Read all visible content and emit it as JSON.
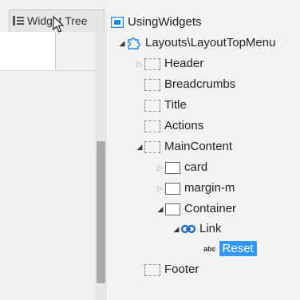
{
  "panel": {
    "tab_label": "Widget Tree"
  },
  "tree": [
    {
      "label": "UsingWidgets",
      "icon": "screen-icon",
      "caret": "none"
    },
    {
      "label": "Layouts\\LayoutTopMenu",
      "icon": "puzzle-icon",
      "caret": "open"
    },
    {
      "label": "Header",
      "icon": "placeholder-icon",
      "caret": "closed"
    },
    {
      "label": "Breadcrumbs",
      "icon": "placeholder-icon",
      "caret": "none"
    },
    {
      "label": "Title",
      "icon": "placeholder-icon",
      "caret": "none"
    },
    {
      "label": "Actions",
      "icon": "placeholder-icon",
      "caret": "none"
    },
    {
      "label": "MainContent",
      "icon": "placeholder-icon",
      "caret": "open"
    },
    {
      "label": "card",
      "icon": "container-icon",
      "caret": "closed"
    },
    {
      "label": "margin-m",
      "icon": "container-icon",
      "caret": "closed"
    },
    {
      "label": "Container",
      "icon": "container-icon",
      "caret": "open"
    },
    {
      "label": "Link",
      "icon": "link-icon",
      "caret": "open"
    },
    {
      "label": "Reset",
      "icon": "text-icon",
      "icon_text": "abc",
      "caret": "none",
      "selected": true
    },
    {
      "label": "Footer",
      "icon": "placeholder-icon",
      "caret": "none"
    }
  ],
  "colors": {
    "selection": "#3399ff",
    "link_icon": "#1565c0",
    "screen_icon": "#1e88e5"
  }
}
